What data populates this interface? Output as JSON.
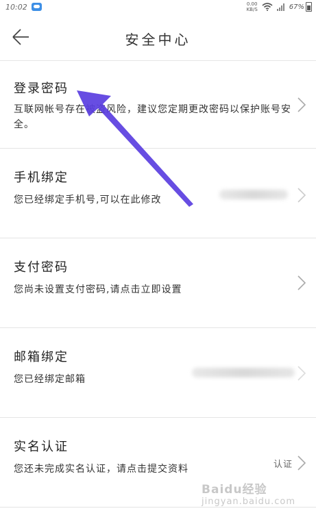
{
  "status_bar": {
    "time": "10:02",
    "net_speed_value": "0.00",
    "net_speed_unit": "KB/S",
    "battery": "67%"
  },
  "header": {
    "title": "安全中心"
  },
  "items": [
    {
      "title": "登录密码",
      "desc": "互联网帐号存在被盗风险，建议您定期更改密码以保护账号安全。"
    },
    {
      "title": "手机绑定",
      "desc": "您已经绑定手机号,可以在此修改"
    },
    {
      "title": "支付密码",
      "desc": "您尚未设置支付密码,请点击立即设置"
    },
    {
      "title": "邮箱绑定",
      "desc": "您已经绑定邮箱"
    },
    {
      "title": "实名认证",
      "desc": "您还未完成实名认证，请点击提交资料",
      "action_label": "认证"
    }
  ],
  "watermark": {
    "brand": "Baidu经验",
    "sub": "jingyan.baidu.com"
  },
  "colors": {
    "annotation_arrow": "#5a3ee0",
    "divider": "#e4e4e4"
  }
}
